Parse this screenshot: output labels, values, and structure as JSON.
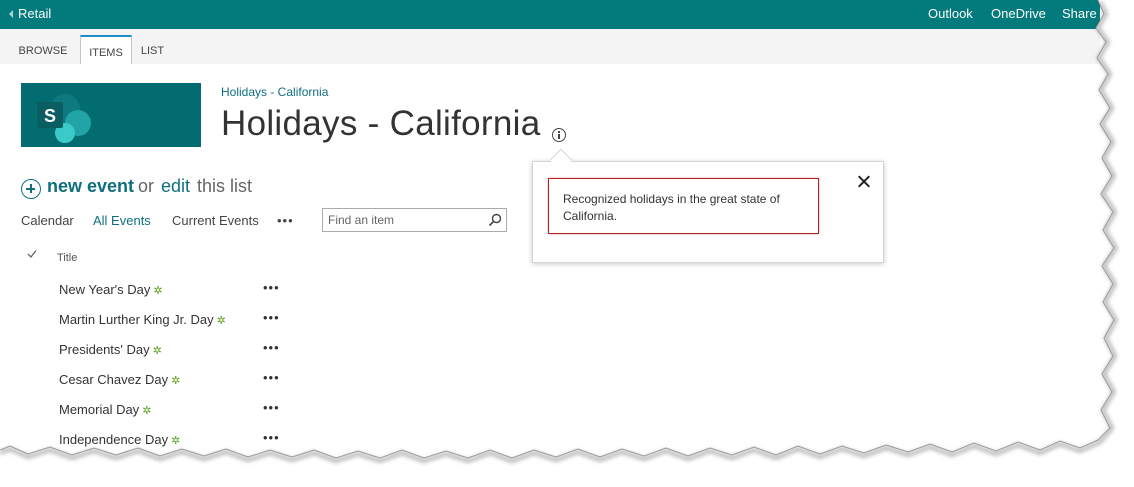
{
  "suite_bar": {
    "site_name": "Retail",
    "links": [
      "Outlook",
      "OneDrive",
      "Share"
    ]
  },
  "ribbon": {
    "tabs": [
      "BROWSE",
      "ITEMS",
      "LIST"
    ],
    "active_tab": "ITEMS"
  },
  "header": {
    "breadcrumb": "Holidays - California",
    "title": "Holidays - California"
  },
  "callout": {
    "description": "Recognized holidays in the great state of California."
  },
  "commands": {
    "new_event": "new event",
    "or": "or",
    "edit": "edit",
    "this_list": "this list"
  },
  "views": {
    "items": [
      "Calendar",
      "All Events",
      "Current Events"
    ],
    "active": "All Events",
    "more": "•••"
  },
  "search": {
    "placeholder": "Find an item",
    "value": ""
  },
  "list": {
    "column_title": "Title",
    "items": [
      {
        "title": "New Year's Day",
        "new_icon": "✲"
      },
      {
        "title": "Martin Lurther King Jr. Day",
        "new_icon": "✲"
      },
      {
        "title": "Presidents' Day",
        "new_icon": "✲"
      },
      {
        "title": "Cesar Chavez Day",
        "new_icon": "✲"
      },
      {
        "title": "Memorial Day",
        "new_icon": "✲"
      },
      {
        "title": "Independence Day",
        "new_icon": "✲"
      }
    ],
    "row_more": "•••"
  },
  "colors": {
    "suite_bar": "#037a7c",
    "accent": "#0f6f80",
    "logo_bg": "#036c70",
    "highlight_border": "#b32020",
    "new_icon": "#5aa51e"
  },
  "icons": [
    "back-chevron-icon",
    "sharepoint-logo-icon",
    "info-icon",
    "close-icon",
    "plus-circle-icon",
    "search-icon",
    "checkmark-icon",
    "new-item-icon",
    "ellipsis-icon"
  ]
}
